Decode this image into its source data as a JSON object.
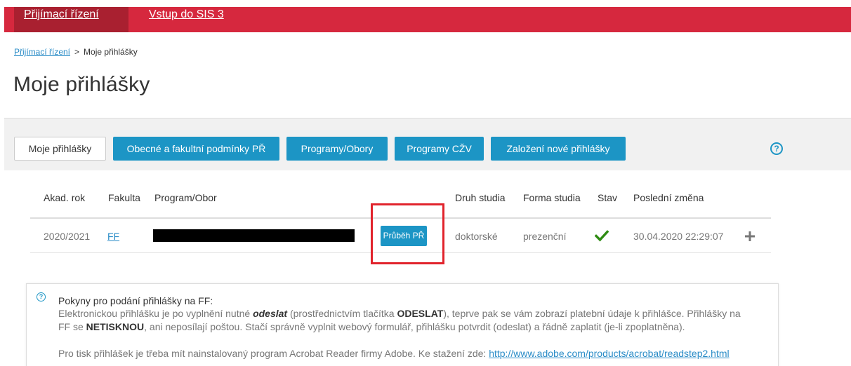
{
  "topnav": {
    "tab_admissions": "Přijímací řízení",
    "tab_sis3": "Vstup do SIS 3"
  },
  "breadcrumb": {
    "root": "Přijímací řízení",
    "separator": ">",
    "current": "Moje přihlášky"
  },
  "page_title": "Moje přihlášky",
  "toolbar": {
    "buttons": [
      "Moje přihlášky",
      "Obecné a fakultní podmínky PŘ",
      "Programy/Obory",
      "Programy CŽV",
      "Založení nové přihlášky"
    ],
    "help_icon": "?"
  },
  "table": {
    "headers": [
      "Akad. rok",
      "Fakulta",
      "Program/Obor",
      "Druh studia",
      "Forma studia",
      "Stav",
      "Poslední změna"
    ],
    "rows": [
      {
        "year": "2020/2021",
        "faculty": "FF",
        "program": "[redacted]",
        "action": "Průběh PŘ",
        "type": "doktorské",
        "form": "prezenční",
        "status_icon": "check-icon",
        "last_change": "30.04.2020 22:29:07",
        "expand_icon": "plus-icon"
      }
    ]
  },
  "info": {
    "heading": "Pokyny pro podání přihlášky na FF:",
    "p1_a": "Elektronickou přihlášku je po vyplnění nutné ",
    "p1_b": "odeslat",
    "p1_c": " (prostřednictvím tlačítka ",
    "p1_d": "ODESLAT",
    "p1_e": "), teprve pak se vám zobrazí platební údaje k přihlášce. Přihlášky na",
    "p2_a": "FF se ",
    "p2_b": "NETISKNOU",
    "p2_c": ", ani neposílají poštou. Stačí správně vyplnit webový formulář, přihlášku potvrdit (odeslat) a řádně zaplatit (je-li zpoplatněna).",
    "p3_a": "Pro tisk přihlášek je třeba mít nainstalovaný program Acrobat Reader firmy Adobe. Ke stažení zde: ",
    "p3_link": "http://www.adobe.com/products/acrobat/readstep2.html"
  },
  "colors": {
    "brand_red": "#d6283e",
    "brand_red_dark": "#a92030",
    "accent_blue": "#1c95c5",
    "success_green": "#2e8b12",
    "highlight_red": "#e1232c"
  }
}
